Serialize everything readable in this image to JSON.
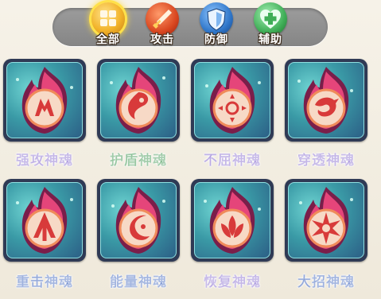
{
  "filter_tabs": [
    {
      "label": "全部",
      "icon": "grid-icon",
      "color": "#f2b32a",
      "active": true
    },
    {
      "label": "攻击",
      "icon": "sword-icon",
      "color": "#d9461f",
      "active": false
    },
    {
      "label": "防御",
      "icon": "shield-icon",
      "color": "#2f76c9",
      "active": false
    },
    {
      "label": "辅助",
      "icon": "heart-plus-icon",
      "color": "#3fae57",
      "active": false
    }
  ],
  "souls": [
    {
      "label": "强攻神魂",
      "symbol": "claw-icon",
      "label_color": "#7a5cc9"
    },
    {
      "label": "护盾神魂",
      "symbol": "yin-yang-icon",
      "label_color": "#2a8a3c"
    },
    {
      "label": "不屈神魂",
      "symbol": "sun-eye-icon",
      "label_color": "#7a5cc9"
    },
    {
      "label": "穿透神魂",
      "symbol": "dragon-icon",
      "label_color": "#7a5cc9"
    },
    {
      "label": "重击神魂",
      "symbol": "arrow-up-icon",
      "label_color": "#2f57b6"
    },
    {
      "label": "能量神魂",
      "symbol": "crescent-icon",
      "label_color": "#2f57b6"
    },
    {
      "label": "恢复神魂",
      "symbol": "lotus-icon",
      "label_color": "#7a5cc9"
    },
    {
      "label": "大招神魂",
      "symbol": "star-burst-icon",
      "label_color": "#2f57b6"
    }
  ]
}
